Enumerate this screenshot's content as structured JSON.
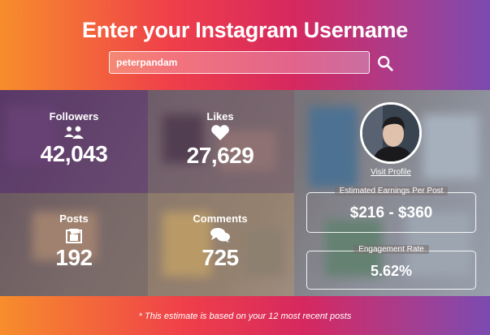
{
  "header": {
    "title": "Enter your Instagram Username"
  },
  "search": {
    "value": "peterpandam",
    "button_icon": "search-icon"
  },
  "stats": {
    "followers": {
      "label": "Followers",
      "value": "42,043",
      "icon": "users-icon"
    },
    "likes": {
      "label": "Likes",
      "value": "27,629",
      "icon": "heart-icon"
    },
    "posts": {
      "label": "Posts",
      "value": "192",
      "icon": "posts-icon"
    },
    "comments": {
      "label": "Comments",
      "value": "725",
      "icon": "comments-icon"
    }
  },
  "profile": {
    "visit_label": "Visit Profile"
  },
  "earnings": {
    "label": "Estimated Earnings Per Post",
    "value": "$216 - $360"
  },
  "engagement": {
    "label": "Engagement Rate",
    "value": "5.62%"
  },
  "footer": {
    "note": "* This estimate is based on your 12 most recent posts"
  },
  "colors": {
    "orange": "#f78d2c",
    "red": "#ef3f4a",
    "magenta": "#d6285f",
    "purple": "#7b4bb1"
  }
}
